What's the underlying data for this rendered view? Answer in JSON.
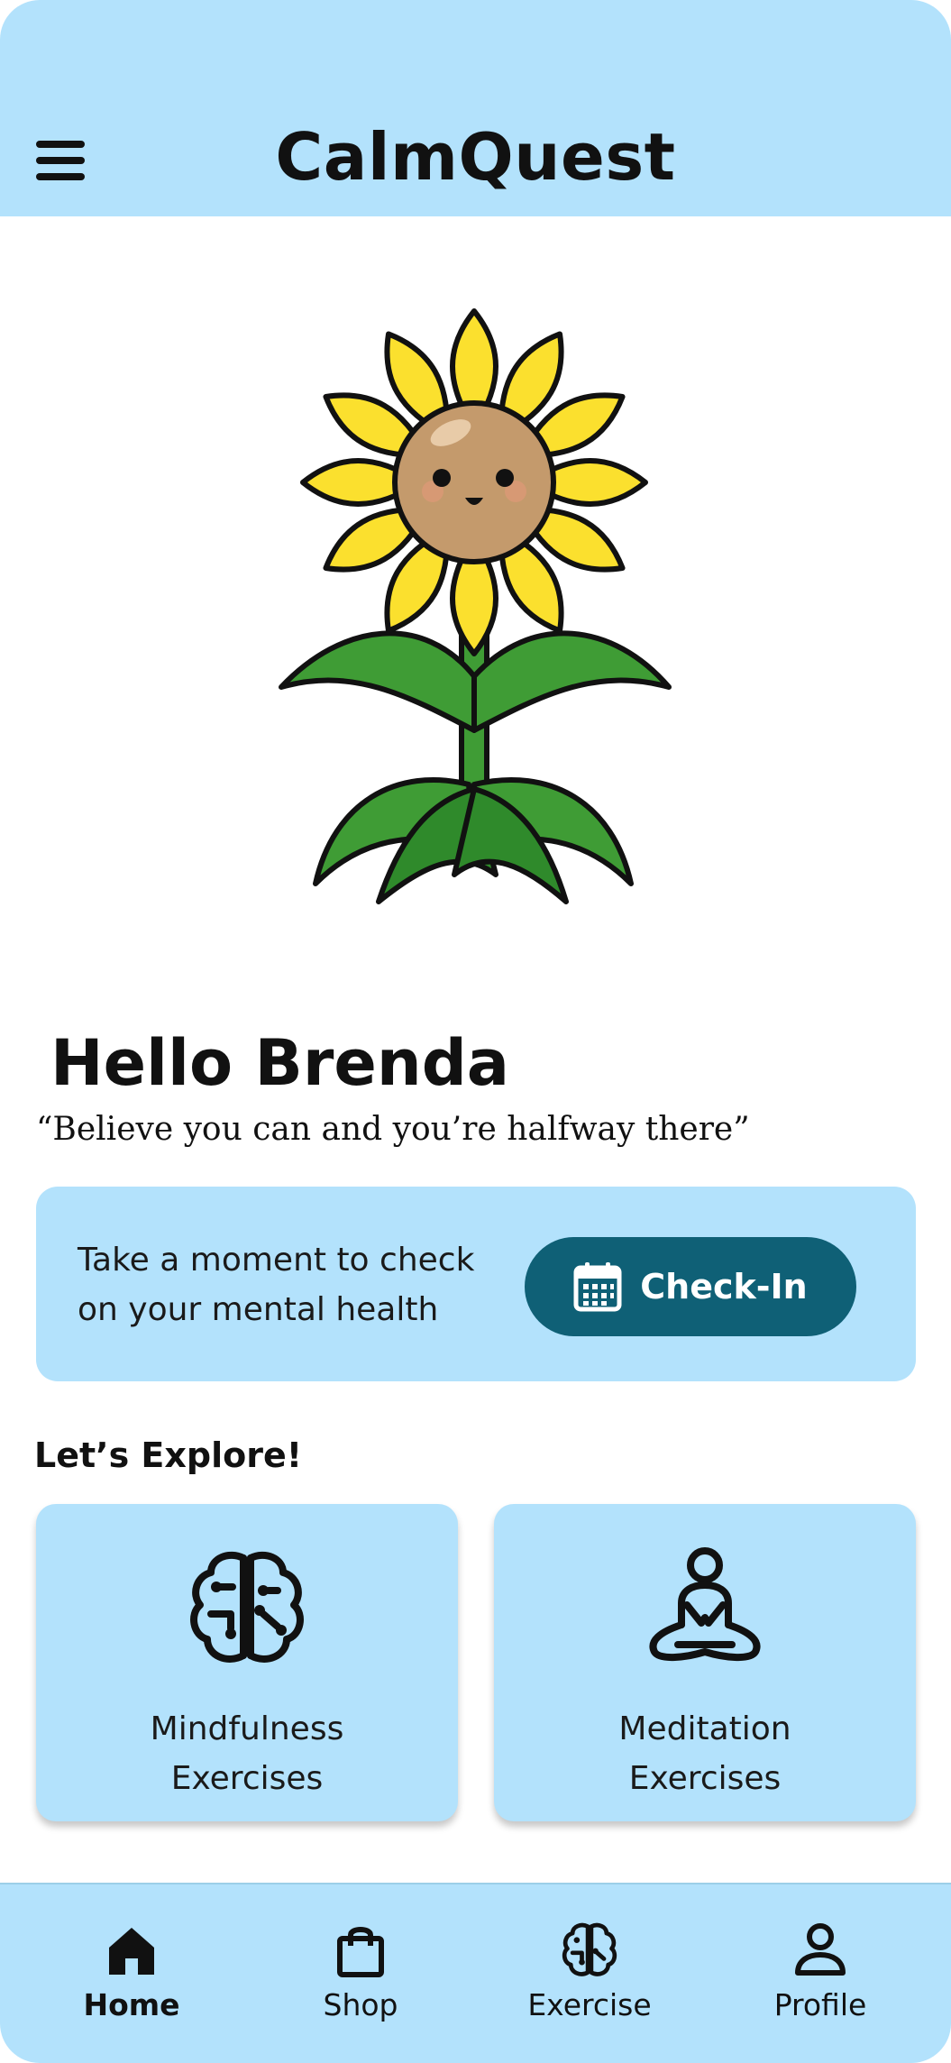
{
  "app": {
    "title": "CalmQuest"
  },
  "greeting": "Hello Brenda",
  "quote": "“Believe you can and you’re halfway there”",
  "checkin": {
    "line1": "Take a moment to check",
    "line2": "on your mental health",
    "button_label": "Check-In"
  },
  "explore": {
    "title": "Let’s Explore!",
    "cards": [
      {
        "line1": "Mindfulness",
        "line2": "Exercises",
        "icon": "brain-icon"
      },
      {
        "line1": "Meditation",
        "line2": "Exercises",
        "icon": "meditation-icon"
      }
    ]
  },
  "nav": {
    "items": [
      {
        "label": "Home",
        "icon": "home-icon",
        "active": true
      },
      {
        "label": "Shop",
        "icon": "shopping-bag-icon",
        "active": false
      },
      {
        "label": "Exercise",
        "icon": "brain-icon",
        "active": false
      },
      {
        "label": "Profile",
        "icon": "user-icon",
        "active": false
      }
    ]
  },
  "colors": {
    "header_bg": "#b3e2fc",
    "button_bg": "#0f6076",
    "petal": "#fbe02e",
    "face": "#c49a6c",
    "leaf": "#3f9c35"
  }
}
